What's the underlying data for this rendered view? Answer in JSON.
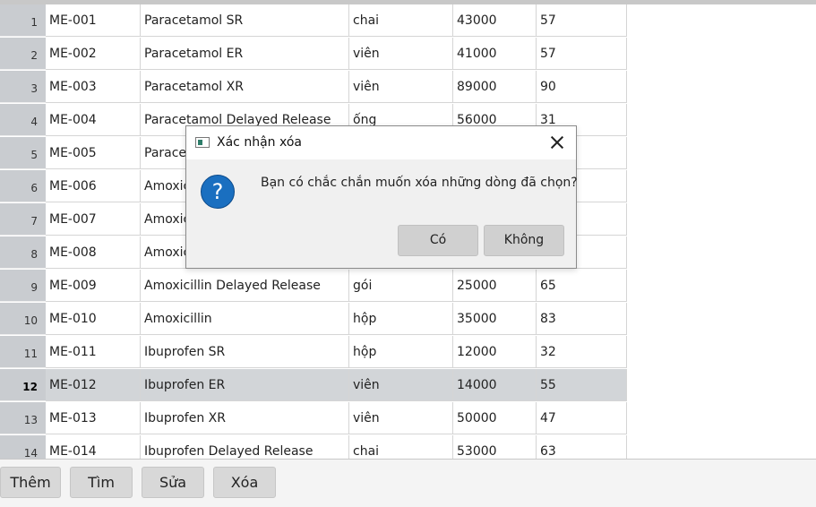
{
  "table": {
    "rows": [
      {
        "num": "1",
        "code": "ME-001",
        "name": "Paracetamol SR",
        "unit": "chai",
        "price": "43000",
        "qty": "57"
      },
      {
        "num": "2",
        "code": "ME-002",
        "name": "Paracetamol ER",
        "unit": "viên",
        "price": "41000",
        "qty": "57"
      },
      {
        "num": "3",
        "code": "ME-003",
        "name": "Paracetamol XR",
        "unit": "viên",
        "price": "89000",
        "qty": "90"
      },
      {
        "num": "4",
        "code": "ME-004",
        "name": "Paracetamol Delayed Release",
        "unit": "ống",
        "price": "56000",
        "qty": "31"
      },
      {
        "num": "5",
        "code": "ME-005",
        "name": "Paracetamol",
        "unit": "",
        "price": "",
        "qty": ""
      },
      {
        "num": "6",
        "code": "ME-006",
        "name": "Amoxicillin SR",
        "unit": "",
        "price": "",
        "qty": ""
      },
      {
        "num": "7",
        "code": "ME-007",
        "name": "Amoxicillin ER",
        "unit": "",
        "price": "",
        "qty": ""
      },
      {
        "num": "8",
        "code": "ME-008",
        "name": "Amoxicillin XR",
        "unit": "",
        "price": "",
        "qty": ""
      },
      {
        "num": "9",
        "code": "ME-009",
        "name": "Amoxicillin Delayed Release",
        "unit": "gói",
        "price": "25000",
        "qty": "65"
      },
      {
        "num": "10",
        "code": "ME-010",
        "name": "Amoxicillin",
        "unit": "hộp",
        "price": "35000",
        "qty": "83"
      },
      {
        "num": "11",
        "code": "ME-011",
        "name": "Ibuprofen SR",
        "unit": "hộp",
        "price": "12000",
        "qty": "32"
      },
      {
        "num": "12",
        "code": "ME-012",
        "name": "Ibuprofen ER",
        "unit": "viên",
        "price": "14000",
        "qty": "55"
      },
      {
        "num": "13",
        "code": "ME-013",
        "name": "Ibuprofen XR",
        "unit": "viên",
        "price": "50000",
        "qty": "47"
      },
      {
        "num": "14",
        "code": "ME-014",
        "name": "Ibuprofen Delayed Release",
        "unit": "chai",
        "price": "53000",
        "qty": "63"
      }
    ],
    "selected_row": "12"
  },
  "buttons": {
    "add": "Thêm",
    "find": "Tìm",
    "edit": "Sửa",
    "delete": "Xóa"
  },
  "dialog": {
    "title": "Xác nhận xóa",
    "message": "Bạn có chắc chắn muốn xóa những dòng đã chọn?",
    "icon": "?",
    "yes": "Có",
    "no": "Không"
  }
}
